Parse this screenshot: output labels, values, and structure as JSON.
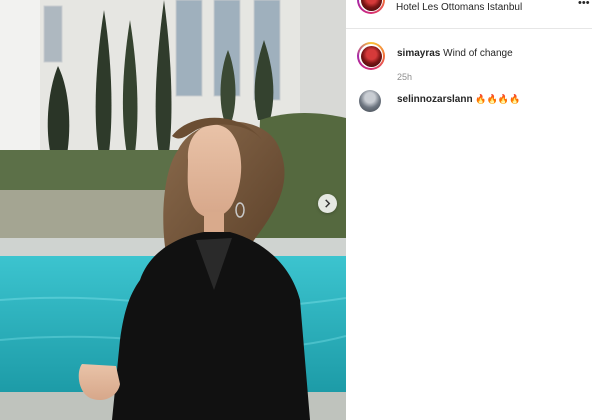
{
  "post": {
    "location": "Hotel Les Ottomans Istanbul",
    "more_label": "•••"
  },
  "caption": {
    "username": "simayras",
    "text": "Wind of change",
    "time": "25h"
  },
  "comments": [
    {
      "username": "selinnozarslann",
      "text": "🔥🔥🔥🔥"
    }
  ],
  "colors": {
    "text": "#262626",
    "secondary_text": "#8e8e8e",
    "pool": "#2fb8c4",
    "story_ring": [
      "#f9c53a",
      "#d62a74",
      "#a628a8"
    ]
  },
  "icons": {
    "carousel_next": "chevron-right-icon",
    "more": "ellipsis-icon"
  }
}
